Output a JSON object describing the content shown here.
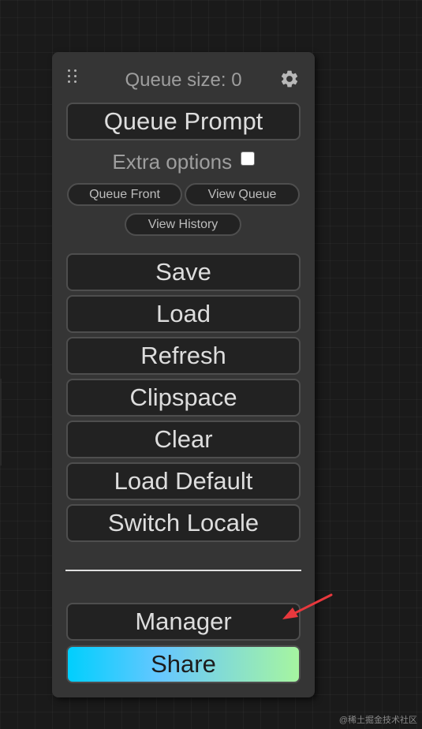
{
  "menu": {
    "queue_size_label": "Queue size: 0",
    "queue_prompt_label": "Queue Prompt",
    "extra_options_label": "Extra options",
    "extra_options_checked": false,
    "queue_front_label": "Queue Front",
    "view_queue_label": "View Queue",
    "view_history_label": "View History",
    "buttons": [
      {
        "label": "Save"
      },
      {
        "label": "Load"
      },
      {
        "label": "Refresh"
      },
      {
        "label": "Clipspace"
      },
      {
        "label": "Clear"
      },
      {
        "label": "Load Default"
      },
      {
        "label": "Switch Locale"
      }
    ],
    "manager_label": "Manager",
    "share_label": "Share"
  },
  "icons": {
    "drag_handle": "drag-handle-icon",
    "settings": "gear-icon"
  },
  "colors": {
    "canvas_background": "#1a1a1a",
    "panel_background": "#353535",
    "button_background": "#222222",
    "share_gradient_start": "#00cffd",
    "share_gradient_end": "#a6f5a0",
    "annotation_arrow": "#e8383d"
  },
  "watermark": "@稀土掘金技术社区"
}
